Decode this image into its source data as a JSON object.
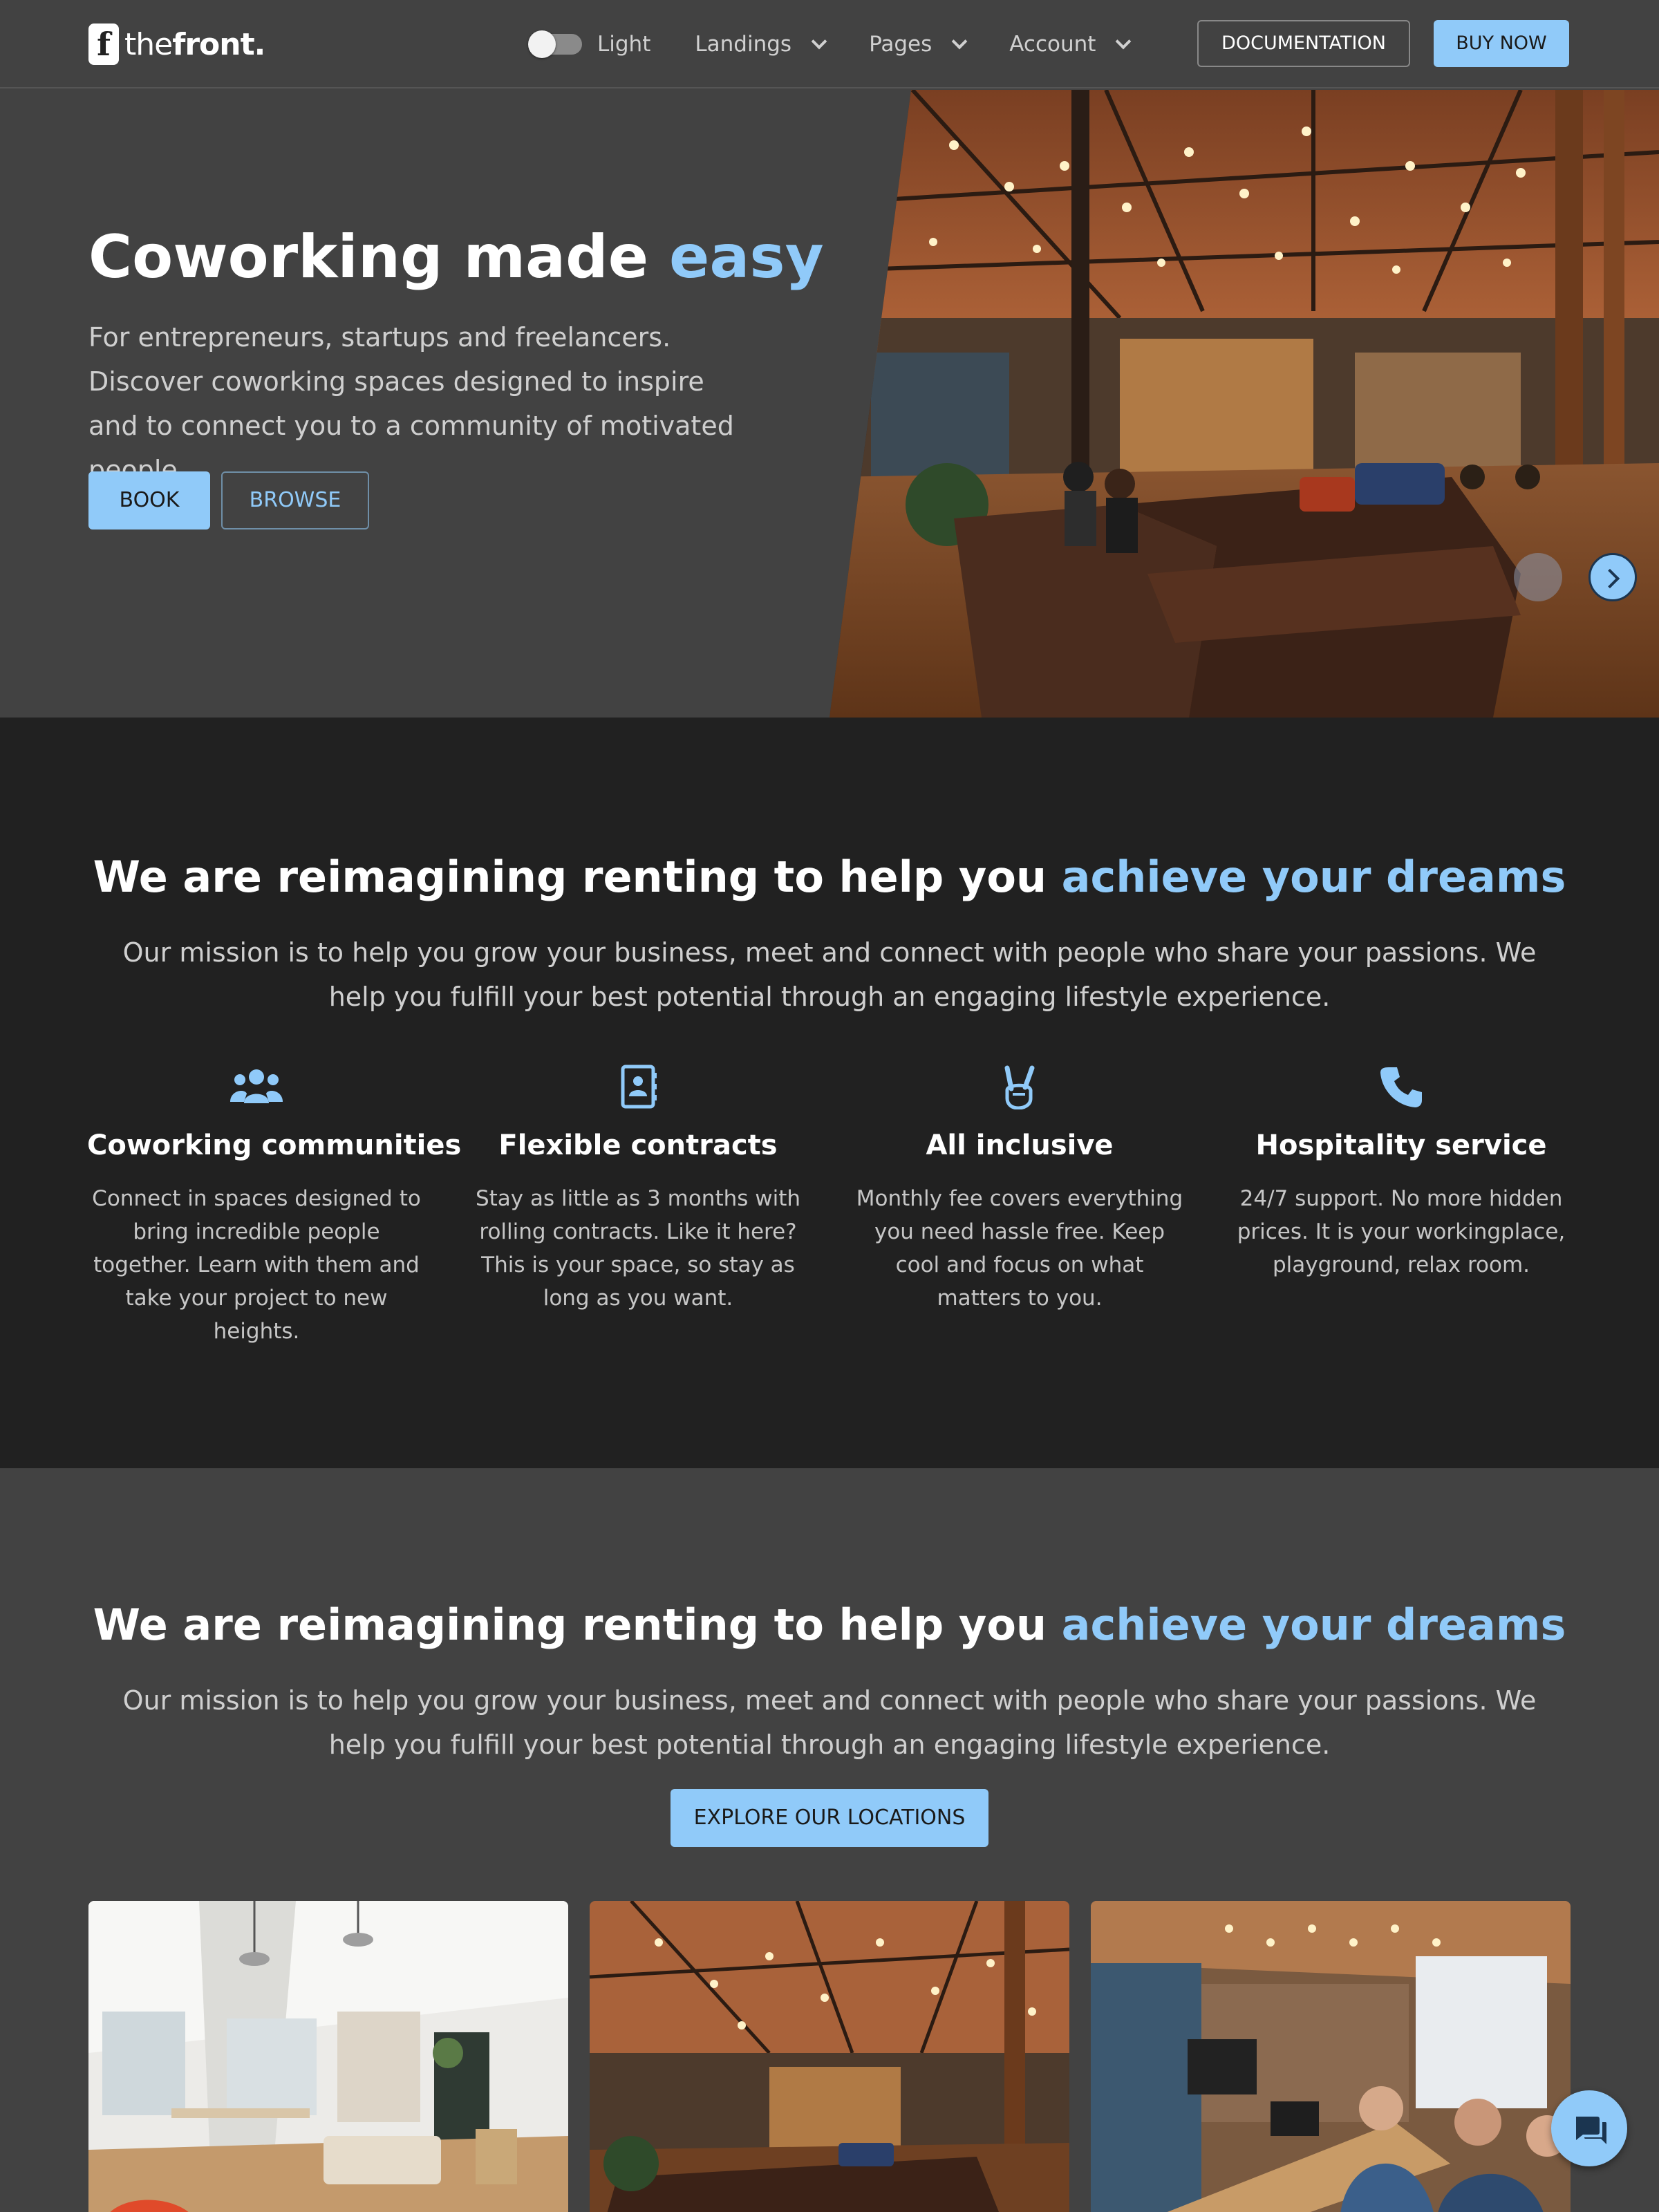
{
  "header": {
    "logo_mark": "f",
    "logo_the": "the",
    "logo_front": "front.",
    "theme_label": "Light",
    "nav": [
      "Landings",
      "Pages",
      "Account"
    ],
    "documentation": "DOCUMENTATION",
    "buy_now": "BUY NOW"
  },
  "hero": {
    "title_main": "Coworking made ",
    "title_accent": "easy",
    "subtitle": "For entrepreneurs, startups and freelancers. Discover coworking spaces designed to inspire and to connect you to a community of motivated people.",
    "book": "BOOK",
    "browse": "BROWSE"
  },
  "features": {
    "title_main": "We are reimagining renting to help you ",
    "title_accent": "achieve your dreams",
    "subtitle": "Our mission is to help you grow your business, meet and connect with people who share your passions. We help you fulfill your best potential through an engaging lifestyle experience.",
    "items": [
      {
        "icon": "users-icon",
        "title": "Coworking communities",
        "text": "Connect in spaces designed to bring incredible people together. Learn with them and take your project to new heights."
      },
      {
        "icon": "contact-book-icon",
        "title": "Flexible contracts",
        "text": "Stay as little as 3 months with rolling contracts. Like it here? This is your space, so stay as long as you want."
      },
      {
        "icon": "peace-hand-icon",
        "title": "All inclusive",
        "text": "Monthly fee covers everything you need hassle free. Keep cool and focus on what matters to you."
      },
      {
        "icon": "phone-icon",
        "title": "Hospitality service",
        "text": "24/7 support. No more hidden prices. It is your workingplace, playground, relax room."
      }
    ]
  },
  "locations": {
    "title_main": "We are reimagining renting to help you ",
    "title_accent": "achieve your dreams",
    "subtitle": "Our mission is to help you grow your business, meet and connect with people who share your passions. We help you fulfill your best potential through an engaging lifestyle experience.",
    "explore": "EXPLORE OUR LOCATIONS"
  },
  "colors": {
    "accent": "#90caf9",
    "page_bg": "#424242",
    "section_dark": "#212121"
  }
}
